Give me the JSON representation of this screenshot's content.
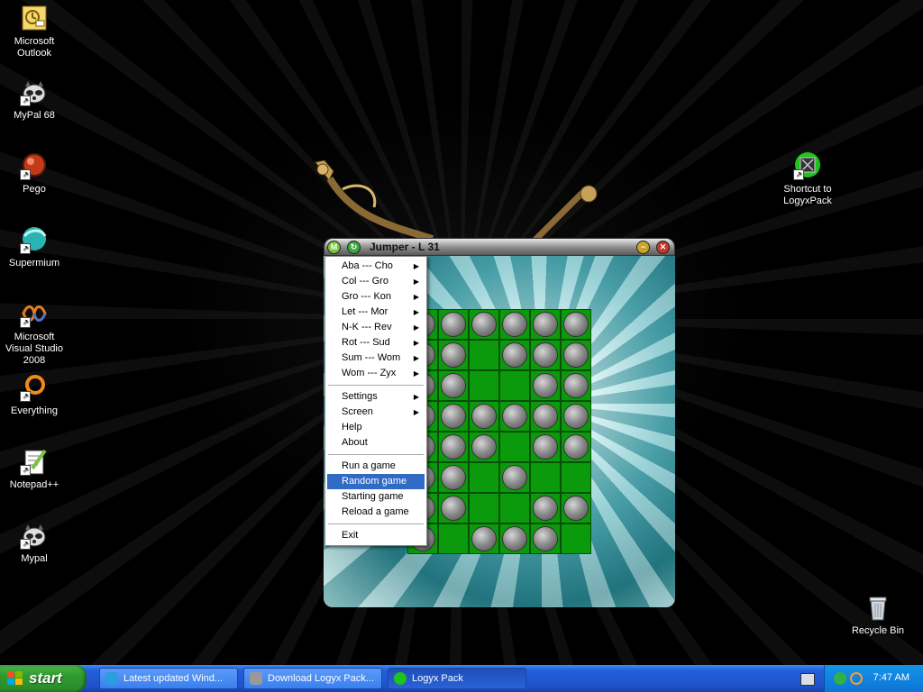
{
  "desktop": {
    "icons": [
      {
        "label": "Microsoft Outlook",
        "icon": "outlook-icon"
      },
      {
        "label": "MyPal 68",
        "icon": "raccoon-icon"
      },
      {
        "label": "Pego",
        "icon": "pego-icon"
      },
      {
        "label": "Supermium",
        "icon": "supermium-icon"
      },
      {
        "label": "Microsoft Visual Studio 2008",
        "icon": "visual-studio-icon"
      },
      {
        "label": "Everything",
        "icon": "everything-icon"
      },
      {
        "label": "Notepad++",
        "icon": "notepadpp-icon"
      },
      {
        "label": "Mypal",
        "icon": "raccoon-icon"
      },
      {
        "label": "Shortcut to LogyxPack",
        "icon": "logyx-icon"
      },
      {
        "label": "Recycle Bin",
        "icon": "recycle-bin-icon"
      }
    ]
  },
  "game_window": {
    "title": "Jumper - L 31",
    "board_rows": [
      ".ppPPPP",
      ".pp.PPp",
      ".pp..Pp",
      ".ppPPPP",
      ".ppP.PP",
      ".pp.P..",
      ".PP..PP",
      ".P.PPp."
    ]
  },
  "menu": {
    "items": [
      {
        "label": "Aba --- Cho",
        "submenu": true
      },
      {
        "label": "Col --- Gro",
        "submenu": true
      },
      {
        "label": "Gro --- Kon",
        "submenu": true
      },
      {
        "label": "Let --- Mor",
        "submenu": true
      },
      {
        "label": "N-K --- Rev",
        "submenu": true
      },
      {
        "label": "Rot --- Sud",
        "submenu": true
      },
      {
        "label": "Sum --- Wom",
        "submenu": true
      },
      {
        "label": "Wom --- Zyx",
        "submenu": true
      },
      {
        "separator": true
      },
      {
        "label": "Settings",
        "submenu": true
      },
      {
        "label": "Screen",
        "submenu": true
      },
      {
        "label": "Help",
        "submenu": false
      },
      {
        "label": "About",
        "submenu": false
      },
      {
        "separator": true
      },
      {
        "label": "Run a game",
        "submenu": false
      },
      {
        "label": "Random game",
        "submenu": false,
        "highlighted": true
      },
      {
        "label": "Starting game",
        "submenu": false
      },
      {
        "label": "Reload a game",
        "submenu": false
      },
      {
        "separator": true
      },
      {
        "label": "Exit",
        "submenu": false
      }
    ]
  },
  "taskbar": {
    "start_label": "start",
    "tasks": [
      {
        "label": "Latest updated Wind...",
        "icon": "ie-icon",
        "active": false
      },
      {
        "label": "Download Logyx Pack...",
        "icon": "raccoon-icon",
        "active": false
      },
      {
        "label": "Logyx Pack",
        "icon": "logyx-icon",
        "active": true
      }
    ],
    "clock": "7:47 AM"
  },
  "colors": {
    "taskbar_blue": "#245edb",
    "start_green": "#2e9b2e",
    "menu_highlight": "#316ac5",
    "board_green": "#0b9a0b"
  }
}
